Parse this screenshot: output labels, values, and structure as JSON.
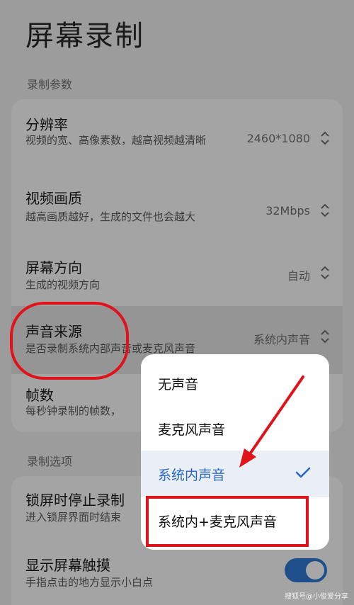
{
  "page": {
    "title": "屏幕录制"
  },
  "sections": {
    "params_label": "录制参数",
    "options_label": "录制选项"
  },
  "params": {
    "resolution": {
      "title": "分辨率",
      "desc": "视频的宽、高像素数，越高视频越清晰",
      "value": "2460*1080"
    },
    "quality": {
      "title": "视频画质",
      "desc": "越高画质越好，生成的文件也会越大",
      "value": "32Mbps"
    },
    "orientation": {
      "title": "屏幕方向",
      "desc": "生成的视频方向",
      "value": "自动"
    },
    "audio": {
      "title": "声音来源",
      "desc": "是否录制系统内部声音或麦克风声音",
      "value": "系统内声音"
    },
    "fps": {
      "title": "帧数",
      "desc": "每秒钟录制的帧数，"
    }
  },
  "options": {
    "lock_stop": {
      "title": "锁屏时停止录制",
      "desc": "进入锁屏界面时结束"
    },
    "show_touches": {
      "title": "显示屏幕触摸",
      "desc": "手指点击的地方显示小白点",
      "enabled": true
    }
  },
  "popup": {
    "items": [
      {
        "label": "无声音",
        "selected": false
      },
      {
        "label": "麦克风声音",
        "selected": false
      },
      {
        "label": "系统内声音",
        "selected": true
      },
      {
        "label": "系统内+麦克风声音",
        "selected": false
      }
    ]
  },
  "watermark": "搜狐号@小俊爱分享",
  "colors": {
    "annotation_red": "#e0121a",
    "accent_blue": "#2a67c4",
    "toggle_on": "#1f4f8a"
  }
}
